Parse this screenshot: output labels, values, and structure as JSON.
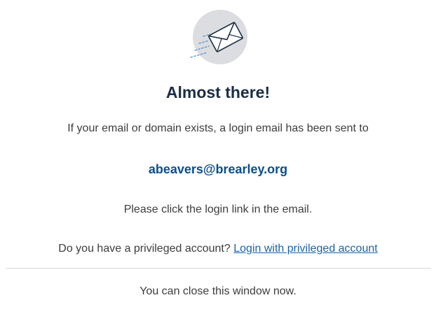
{
  "header": {
    "title": "Almost there!"
  },
  "message": {
    "intro": "If your email or domain exists, a login email has been sent to",
    "email": "abeavers@brearley.org",
    "instructions": "Please click the login link in the email."
  },
  "privileged": {
    "question": "Do you have a privileged account?",
    "link_label": "Login with privileged account"
  },
  "footer": {
    "closing": "You can close this window now."
  },
  "icons": {
    "illustration": "sent-envelope-icon"
  },
  "colors": {
    "title": "#1b2e45",
    "email": "#0b4f8a",
    "link": "#1a63a8",
    "icon_circle": "#dcdde0"
  }
}
